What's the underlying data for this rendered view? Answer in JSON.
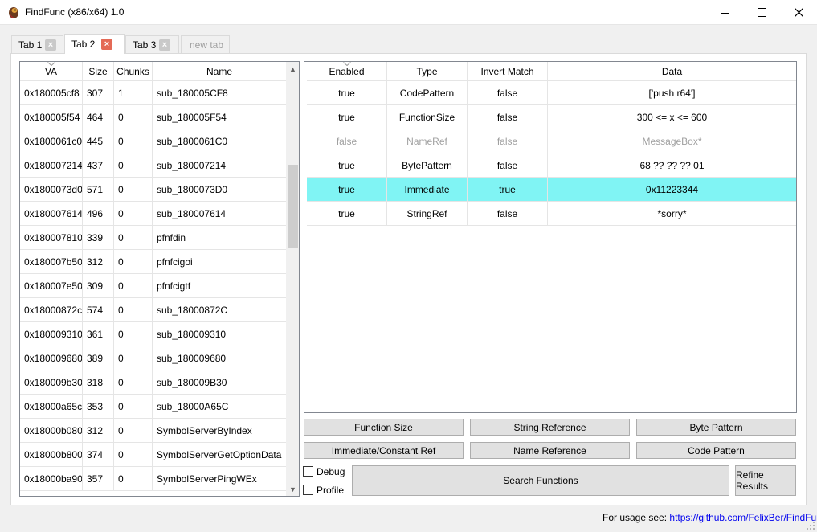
{
  "window": {
    "title": "FindFunc (x86/x64) 1.0",
    "icon": "parrot-app-icon",
    "controls": [
      "minimize-icon",
      "maximize-icon",
      "close-icon"
    ]
  },
  "tabs": [
    {
      "label": "Tab 1",
      "active": false
    },
    {
      "label": "Tab 2",
      "active": true
    },
    {
      "label": "Tab 3",
      "active": false
    },
    {
      "label": "new tab",
      "ghost": true
    }
  ],
  "functions_table": {
    "headers": [
      "VA",
      "Size",
      "Chunks",
      "Name"
    ],
    "rows": [
      {
        "va": "0x180005cf8",
        "size": "307",
        "chunks": "1",
        "name": "sub_180005CF8"
      },
      {
        "va": "0x180005f54",
        "size": "464",
        "chunks": "0",
        "name": "sub_180005F54"
      },
      {
        "va": "0x1800061c0",
        "size": "445",
        "chunks": "0",
        "name": "sub_1800061C0"
      },
      {
        "va": "0x180007214",
        "size": "437",
        "chunks": "0",
        "name": "sub_180007214"
      },
      {
        "va": "0x1800073d0",
        "size": "571",
        "chunks": "0",
        "name": "sub_1800073D0"
      },
      {
        "va": "0x180007614",
        "size": "496",
        "chunks": "0",
        "name": "sub_180007614"
      },
      {
        "va": "0x180007810",
        "size": "339",
        "chunks": "0",
        "name": "pfnfdin"
      },
      {
        "va": "0x180007b50",
        "size": "312",
        "chunks": "0",
        "name": "pfnfcigoi"
      },
      {
        "va": "0x180007e50",
        "size": "309",
        "chunks": "0",
        "name": "pfnfcigtf"
      },
      {
        "va": "0x18000872c",
        "size": "574",
        "chunks": "0",
        "name": "sub_18000872C"
      },
      {
        "va": "0x180009310",
        "size": "361",
        "chunks": "0",
        "name": "sub_180009310"
      },
      {
        "va": "0x180009680",
        "size": "389",
        "chunks": "0",
        "name": "sub_180009680"
      },
      {
        "va": "0x180009b30",
        "size": "318",
        "chunks": "0",
        "name": "sub_180009B30"
      },
      {
        "va": "0x18000a65c",
        "size": "353",
        "chunks": "0",
        "name": "sub_18000A65C"
      },
      {
        "va": "0x18000b080",
        "size": "312",
        "chunks": "0",
        "name": "SymbolServerByIndex"
      },
      {
        "va": "0x18000b800",
        "size": "374",
        "chunks": "0",
        "name": "SymbolServerGetOptionData"
      },
      {
        "va": "0x18000ba90",
        "size": "357",
        "chunks": "0",
        "name": "SymbolServerPingWEx"
      }
    ]
  },
  "rules_table": {
    "headers": [
      "Enabled",
      "Type",
      "Invert Match",
      "Data"
    ],
    "rows": [
      {
        "enabled": "true",
        "type": "CodePattern",
        "invert": "false",
        "data": "['push r64']",
        "state": "normal"
      },
      {
        "enabled": "true",
        "type": "FunctionSize",
        "invert": "false",
        "data": "300 <= x <= 600",
        "state": "normal"
      },
      {
        "enabled": "false",
        "type": "NameRef",
        "invert": "false",
        "data": "MessageBox*",
        "state": "disabled"
      },
      {
        "enabled": "true",
        "type": "BytePattern",
        "invert": "false",
        "data": "68  ?? ?? ?? 01",
        "state": "normal"
      },
      {
        "enabled": "true",
        "type": "Immediate",
        "invert": "true",
        "data": "0x11223344",
        "state": "selected"
      },
      {
        "enabled": "true",
        "type": "StringRef",
        "invert": "false",
        "data": "*sorry*",
        "state": "normal"
      }
    ]
  },
  "buttons": {
    "function_size": "Function Size",
    "string_reference": "String Reference",
    "byte_pattern": "Byte Pattern",
    "immediate_ref": "Immediate/Constant Ref",
    "name_reference": "Name Reference",
    "code_pattern": "Code Pattern",
    "search_functions": "Search Functions",
    "refine_results": "Refine Results"
  },
  "checkboxes": {
    "debug": {
      "label": "Debug",
      "checked": false
    },
    "profile": {
      "label": "Profile",
      "checked": false
    }
  },
  "status": {
    "prefix": "For usage see: ",
    "link": "https://github.com/FelixBer/FindFunc"
  },
  "colors": {
    "selected_row": "#80f4f4",
    "close_tab_active": "#e46a56",
    "link": "#0000ee"
  }
}
